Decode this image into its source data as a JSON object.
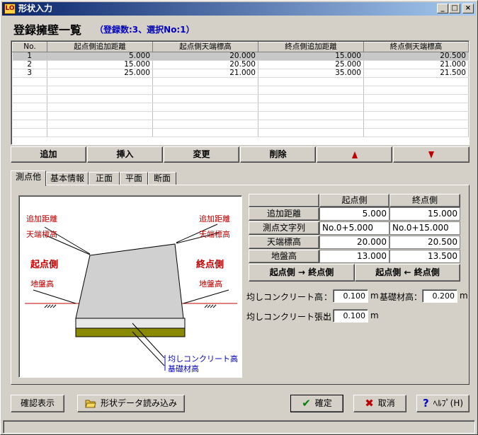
{
  "window": {
    "title": "形状入力",
    "icon_text": "LO",
    "minimize": "_",
    "maximize": "□",
    "close": "×"
  },
  "list": {
    "title": "登録擁壁一覧",
    "count_text": "（登録数:3、選択No:1）",
    "columns": [
      "No.",
      "起点側追加距離",
      "起点側天端標高",
      "終点側追加距離",
      "終点側天端標高"
    ],
    "rows": [
      [
        "1",
        "5.000",
        "20.000",
        "15.000",
        "20.500"
      ],
      [
        "2",
        "15.000",
        "20.500",
        "25.000",
        "21.000"
      ],
      [
        "3",
        "25.000",
        "21.000",
        "35.000",
        "21.500"
      ]
    ]
  },
  "row_buttons": {
    "add": "追加",
    "insert": "挿入",
    "change": "変更",
    "delete": "削除"
  },
  "tabs": [
    "測点他",
    "基本情報",
    "正面",
    "平面",
    "断面"
  ],
  "figure": {
    "left_dist": "追加距離",
    "left_top": "天端標高",
    "left_side": "起点側",
    "left_ground": "地盤高",
    "right_dist": "追加距離",
    "right_top": "天端標高",
    "right_side": "終点側",
    "right_ground": "地盤高",
    "leveling": "均しコンクリート高",
    "foundation": "基礎材高"
  },
  "params": {
    "col_start": "起点側",
    "col_end": "終点側",
    "rows": [
      {
        "label": "追加距離",
        "start": "5.000",
        "end": "15.000"
      },
      {
        "label": "測点文字列",
        "start": "No.0+5.000",
        "end": "No.0+15.000"
      },
      {
        "label": "天端標高",
        "start": "20.000",
        "end": "20.500"
      },
      {
        "label": "地盤高",
        "start": "13.000",
        "end": "13.500"
      }
    ],
    "copy_start_to_end": "起点側 → 終点側",
    "copy_end_to_start": "起点側 ← 終点側"
  },
  "fields": {
    "leveling_label": "均しコンクリート高",
    "colon": "：",
    "leveling_value": "0.100",
    "unit_m": "m",
    "foundation_label": "基礎材高：",
    "foundation_value": "0.200",
    "overhang_label": "均しコンクリート張出し",
    "overhang_value": "0.100"
  },
  "footer": {
    "confirm_view": "確認表示",
    "load_shape": "形状データ読み込み",
    "ok": "確定",
    "cancel": "取消",
    "help": "ﾍﾙﾌﾟ(H)"
  },
  "colors": {
    "titlebar": "#0a246a",
    "label_red": "#c00000",
    "label_blue": "#0000c0",
    "wall_fill": "#d0d0d0",
    "foundation_fill": "#8a8a00"
  }
}
